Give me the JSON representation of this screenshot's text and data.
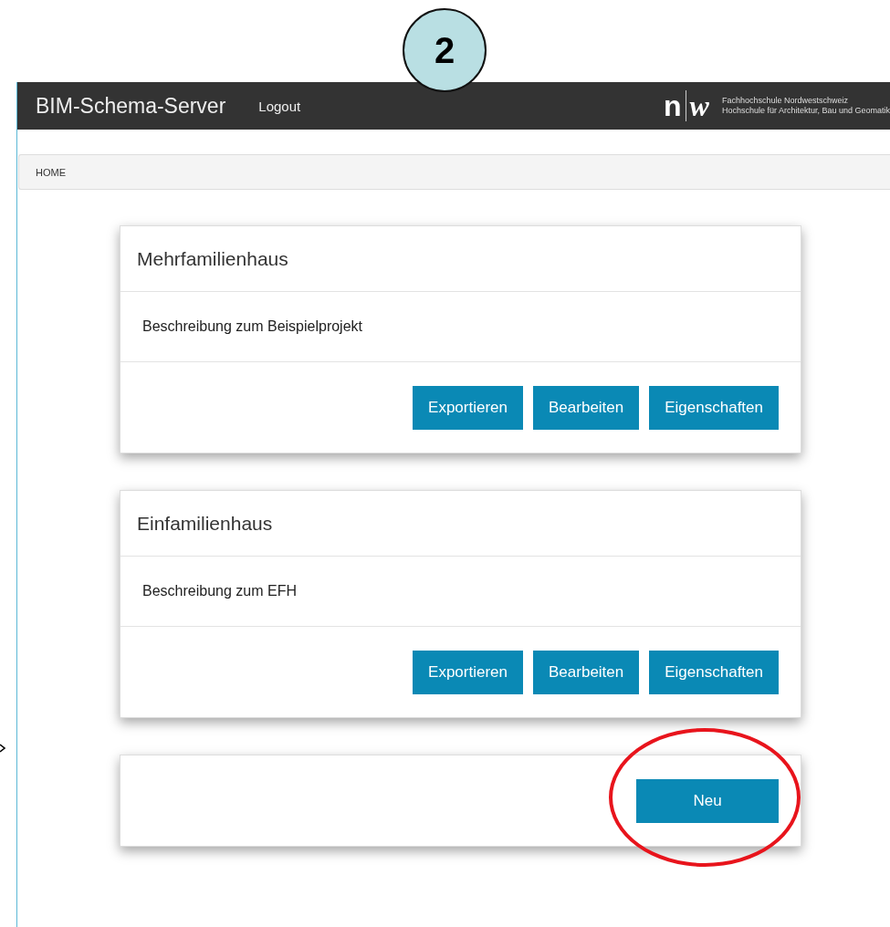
{
  "annotation": {
    "step": "2"
  },
  "header": {
    "title": "BIM-Schema-Server",
    "logout": "Logout",
    "logo": {
      "left": "n",
      "right": "w",
      "line_1": "Fachhochschule Nordwestschweiz",
      "line_2": "Hochschule für Architektur, Bau und Geomatik"
    }
  },
  "breadcrumb": "HOME",
  "projects": [
    {
      "title": "Mehrfamilienhaus",
      "description": "Beschreibung zum Beispielprojekt",
      "buttons": [
        "Exportieren",
        "Bearbeiten",
        "Eigenschaften"
      ]
    },
    {
      "title": "Einfamilienhaus",
      "description": "Beschreibung zum EFH",
      "buttons": [
        "Exportieren",
        "Bearbeiten",
        "Eigenschaften"
      ]
    }
  ],
  "new_button": {
    "label": "Neu",
    "highlighted": true
  }
}
